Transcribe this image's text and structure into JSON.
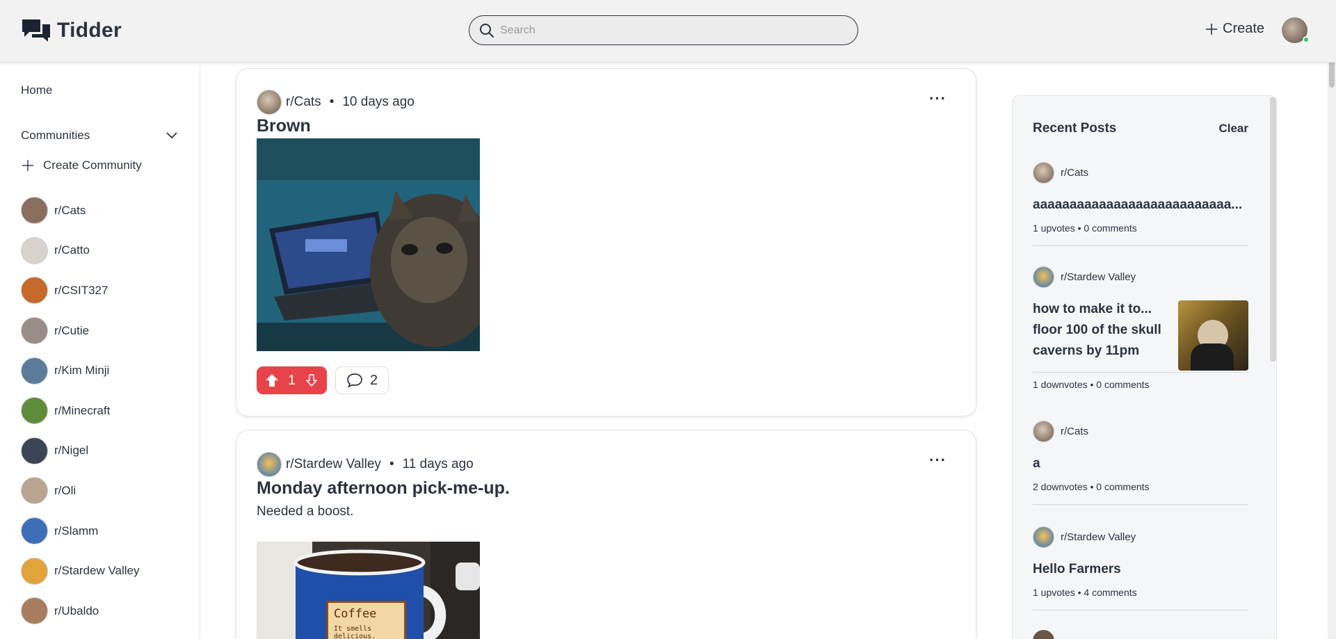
{
  "header": {
    "app_name": "Tidder",
    "search_placeholder": "Search",
    "create_label": "Create"
  },
  "sidebar": {
    "home_label": "Home",
    "communities_label": "Communities",
    "create_community_label": "Create Community",
    "communities": [
      {
        "name": "r/Cats",
        "avatar_color": "#8a6f5c"
      },
      {
        "name": "r/Catto",
        "avatar_color": "#d8d3cc"
      },
      {
        "name": "r/CSIT327",
        "avatar_color": "#c8692c"
      },
      {
        "name": "r/Cutie",
        "avatar_color": "#9a8c86"
      },
      {
        "name": "r/Kim Minji",
        "avatar_color": "#5b7b9a"
      },
      {
        "name": "r/Minecraft",
        "avatar_color": "#5e8c3a"
      },
      {
        "name": "r/Nigel",
        "avatar_color": "#3a4656"
      },
      {
        "name": "r/Oli",
        "avatar_color": "#b9a48f"
      },
      {
        "name": "r/Slamm",
        "avatar_color": "#3d6fb8"
      },
      {
        "name": "r/Stardew Valley",
        "avatar_color": "#e2a33a"
      },
      {
        "name": "r/Ubaldo",
        "avatar_color": "#a87c5e"
      }
    ]
  },
  "feed": {
    "posts": [
      {
        "community": "r/Cats",
        "time": "10 days ago",
        "title": "Brown",
        "body": "",
        "votes": "1",
        "comments": "2"
      },
      {
        "community": "r/Stardew Valley",
        "time": "11 days ago",
        "title": "Monday afternoon pick-me-up.",
        "body": "Needed a boost.",
        "image_caption_1": "Coffee",
        "image_caption_2": "It smells delicious."
      }
    ]
  },
  "recent_posts": {
    "title": "Recent Posts",
    "clear_label": "Clear",
    "items": [
      {
        "community": "r/Cats",
        "title": "aaaaaaaaaaaaaaaaaaaaaaaaaaa...",
        "stats": "1 upvotes • 0 comments"
      },
      {
        "community": "r/Stardew Valley",
        "title": "how to make it to... floor 100 of the skull caverns by 11pm",
        "stats": "1 downvotes • 0 comments"
      },
      {
        "community": "r/Cats",
        "title": "a",
        "stats": "2 downvotes • 0 comments"
      },
      {
        "community": "r/Stardew Valley",
        "title": "Hello Farmers",
        "stats": "1 upvotes • 4 comments"
      }
    ]
  },
  "colors": {
    "accent_red": "#e8434a",
    "text_dark": "#2b3340",
    "online_green": "#2ecc71"
  }
}
